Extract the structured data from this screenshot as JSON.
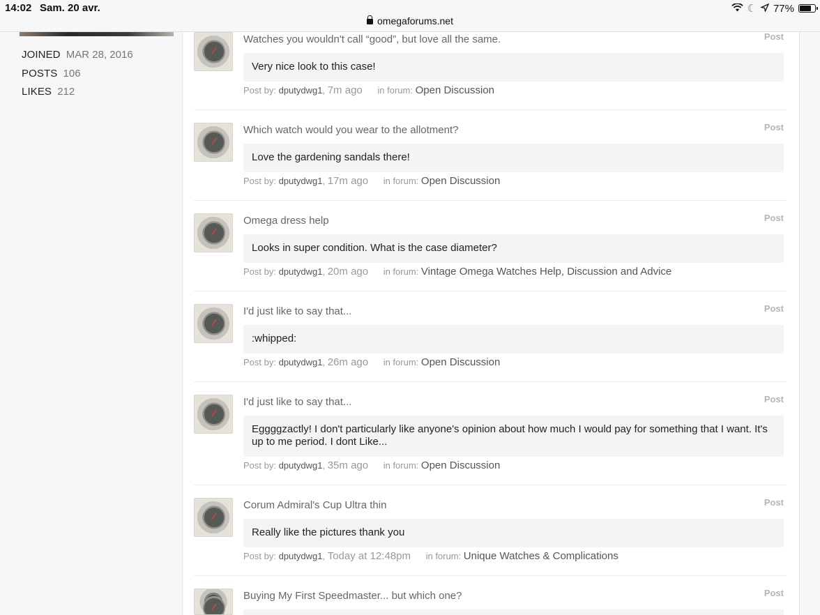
{
  "status": {
    "time": "14:02",
    "date": "Sam. 20 avr.",
    "url": "omegaforums.net",
    "battery": "77%"
  },
  "profile": {
    "joined_label": "JOINED",
    "joined_value": "MAR 28, 2016",
    "posts_label": "POSTS",
    "posts_value": "106",
    "likes_label": "LIKES",
    "likes_value": "212"
  },
  "activities": [
    {
      "title": "Watches you wouldn't call “good”, but love all the same.",
      "type": "Post",
      "quote": "Very nice look to this case!",
      "post_by": "Post by:",
      "user": "dputydwg1",
      "time": "7m ago",
      "in_forum": "in forum:",
      "forum": "Open Discussion"
    },
    {
      "title": "Which watch would you wear to the allotment?",
      "type": "Post",
      "quote": "Love the gardening sandals there!",
      "post_by": "Post by:",
      "user": "dputydwg1",
      "time": "17m ago",
      "in_forum": "in forum:",
      "forum": "Open Discussion"
    },
    {
      "title": "Omega dress help",
      "type": "Post",
      "quote": "Looks in super condition. What is the case diameter?",
      "post_by": "Post by:",
      "user": "dputydwg1",
      "time": "20m ago",
      "in_forum": "in forum:",
      "forum": "Vintage Omega Watches Help, Discussion and Advice"
    },
    {
      "title": "I'd just like to say that...",
      "type": "Post",
      "quote": ":whipped:",
      "post_by": "Post by:",
      "user": "dputydwg1",
      "time": "26m ago",
      "in_forum": "in forum:",
      "forum": "Open Discussion"
    },
    {
      "title": "I'd just like to say that...",
      "type": "Post",
      "quote": "Eggggzactly! I don't particularly like anyone's opinion about how much I would pay for something that I want. It's up to me period. I dont Like...",
      "post_by": "Post by:",
      "user": "dputydwg1",
      "time": "35m ago",
      "in_forum": "in forum:",
      "forum": "Open Discussion"
    },
    {
      "title": "Corum Admiral's Cup Ultra thin",
      "type": "Post",
      "quote": "Really like the pictures thank you",
      "post_by": "Post by:",
      "user": "dputydwg1",
      "time": "Today at 12:48pm",
      "in_forum": "in forum:",
      "forum": "Unique Watches & Complications"
    },
    {
      "title": "Buying My First Speedmaster... but which one?",
      "type": "Post"
    }
  ]
}
